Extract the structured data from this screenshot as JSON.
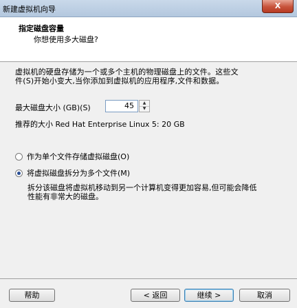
{
  "window": {
    "title": "新建虚拟机向导",
    "close_label": "X"
  },
  "header": {
    "title": "指定磁盘容量",
    "subtitle": "你想使用多大磁盘?"
  },
  "description": {
    "line1": "虚拟机的硬盘存储为一个或多个主机的物理磁盘上的文件。这些文",
    "line2": "件(S)开始小变大,当你添加到虚拟机的应用程序,文件和数据。"
  },
  "disk_size": {
    "label": "最大磁盘大小 (GB)(S)",
    "value": "45",
    "recommend": "推荐的大小 Red Hat Enterprise Linux 5: 20 GB"
  },
  "options": {
    "single_file": {
      "label": "作为单个文件存储虚拟磁盘(O)",
      "checked": false
    },
    "multi_file": {
      "label": "将虚拟磁盘拆分为多个文件(M)",
      "checked": true
    },
    "multi_desc_line1": "拆分该磁盘将虚拟机移动到另一个计算机变得更加容易,但可能会降低",
    "multi_desc_line2": "性能有非常大的磁盘。"
  },
  "footer": {
    "help": "帮助",
    "back": "< 返回",
    "next": "继续 >",
    "cancel": "取消"
  }
}
